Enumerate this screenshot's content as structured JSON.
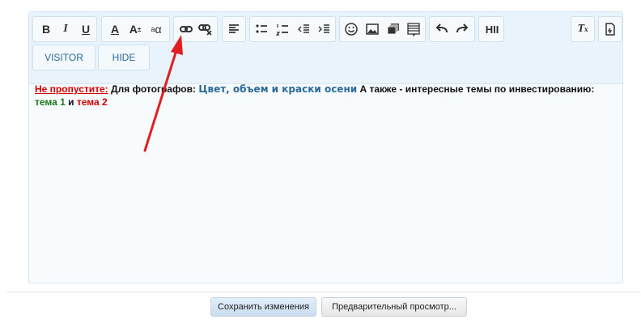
{
  "toolbar": {
    "bold": "B",
    "italic": "I",
    "underline": "U",
    "font_color": "A",
    "font_size": "A",
    "font_size_sup": "±",
    "superscript": "a",
    "superscript_sub": "α",
    "heading": "HII",
    "remove_format": "T",
    "remove_format_sub": "x"
  },
  "buttons": {
    "visitor": "VISITOR",
    "hide": "HIDE"
  },
  "content": {
    "dont_miss": "Не пропустите:",
    "for_photographers": "Для фотографов:",
    "link1": "Цвет, объем и краски осени",
    "also": "А также - интересные темы по инвестированию:",
    "link2": "тема 1",
    "and": "и",
    "link3": "тема 2"
  },
  "actions": {
    "save": "Сохранить изменения",
    "preview": "Предварительный просмотр..."
  },
  "colors": {
    "annotation_arrow": "#e02020",
    "link_blue": "#2b6a9a",
    "link_green": "#1b7a1b",
    "link_red": "#d40000"
  }
}
